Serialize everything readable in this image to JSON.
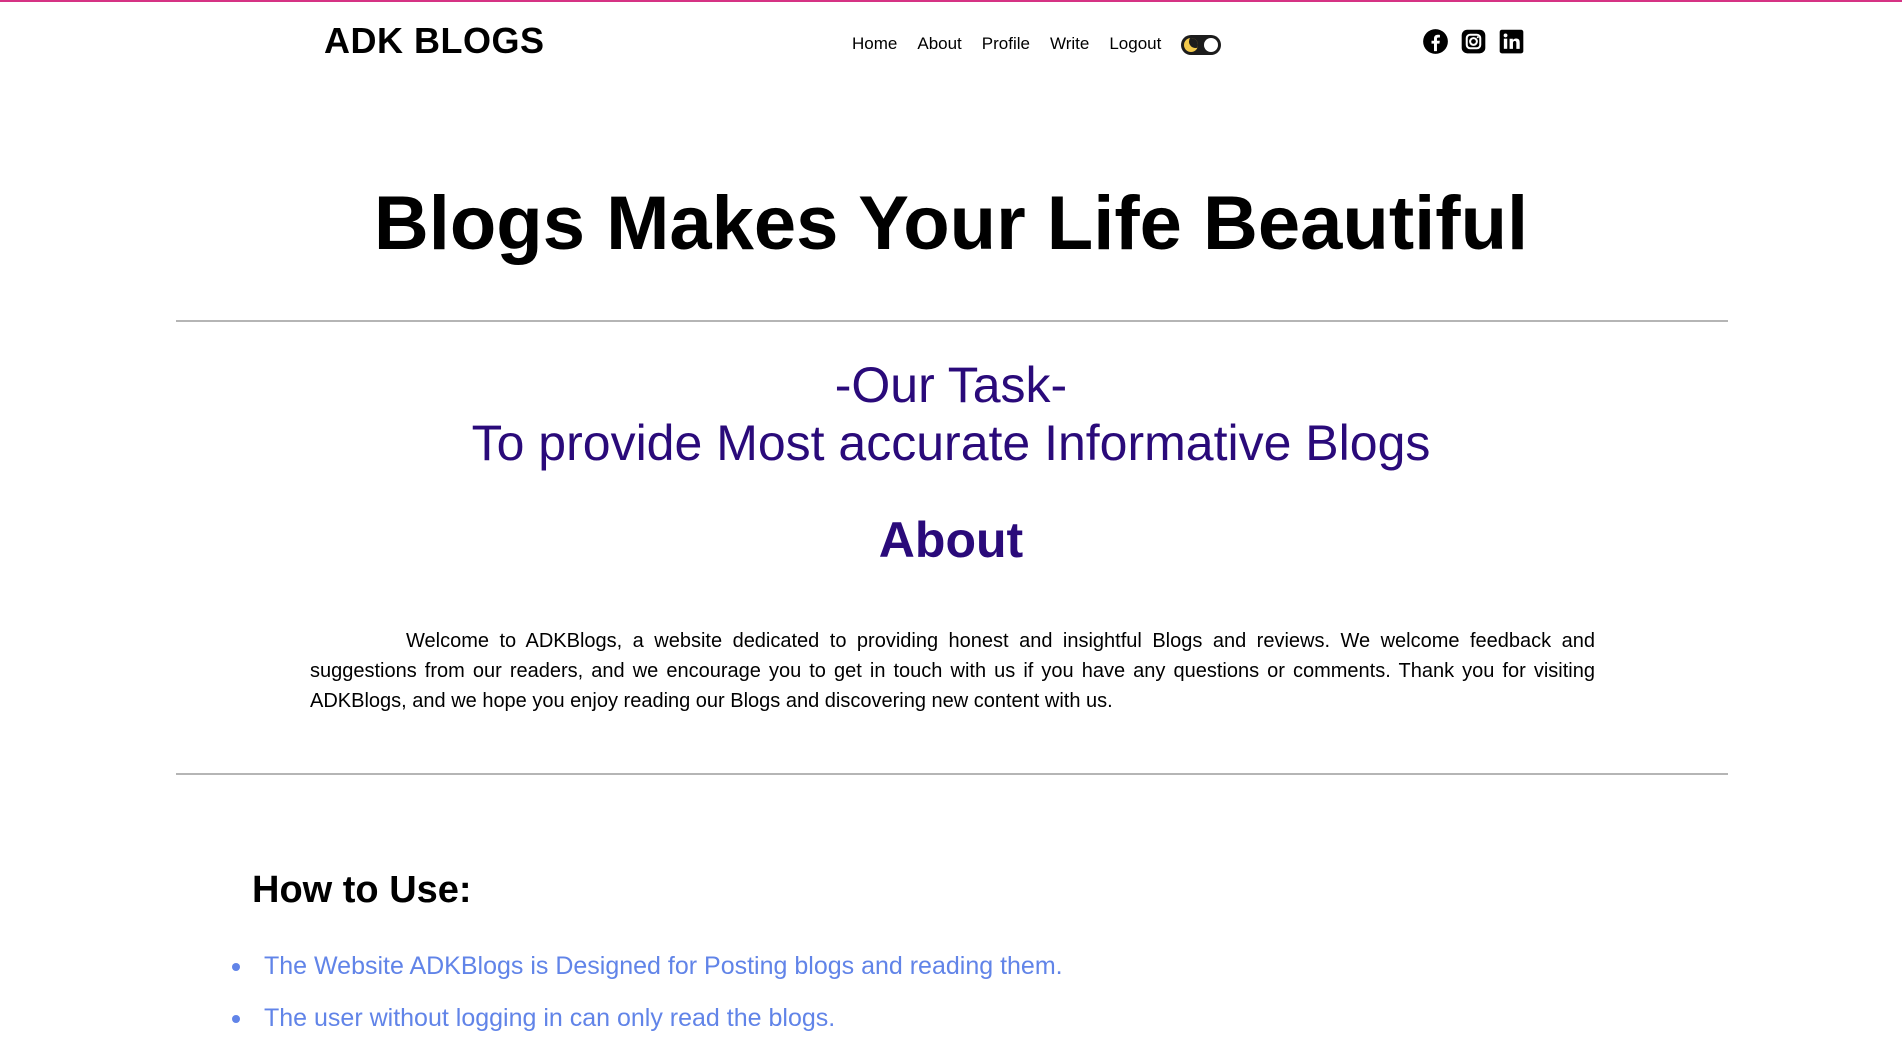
{
  "navbar": {
    "brand": "ADK BLOGS",
    "links": [
      "Home",
      "About",
      "Profile",
      "Write",
      "Logout"
    ],
    "theme_toggle": {
      "icon": "moon-icon",
      "state": "dark-mode-toggle"
    },
    "social": [
      "facebook-icon",
      "instagram-icon",
      "linkedin-icon"
    ]
  },
  "hero": {
    "title": "Blogs Makes Your Life Beautiful"
  },
  "task": {
    "line1": "-Our Task-",
    "line2": "To provide Most accurate Informative Blogs"
  },
  "about": {
    "heading": "About",
    "text": "Welcome to ADKBlogs, a website dedicated to providing honest and insightful Blogs and reviews. We welcome feedback and suggestions from our readers, and we encourage you to get in touch with us if you have any questions or comments. Thank you for visiting ADKBlogs, and we hope you enjoy reading our Blogs and discovering new content with us."
  },
  "howto": {
    "heading": "How to Use:",
    "items": [
      "The Website ADKBlogs is Designed for Posting blogs and reading them.",
      "The user without logging in can only read the blogs."
    ]
  },
  "colors": {
    "accent_top": "#d63384",
    "task_text": "#2a0a7a",
    "list_text": "#6184e8"
  }
}
